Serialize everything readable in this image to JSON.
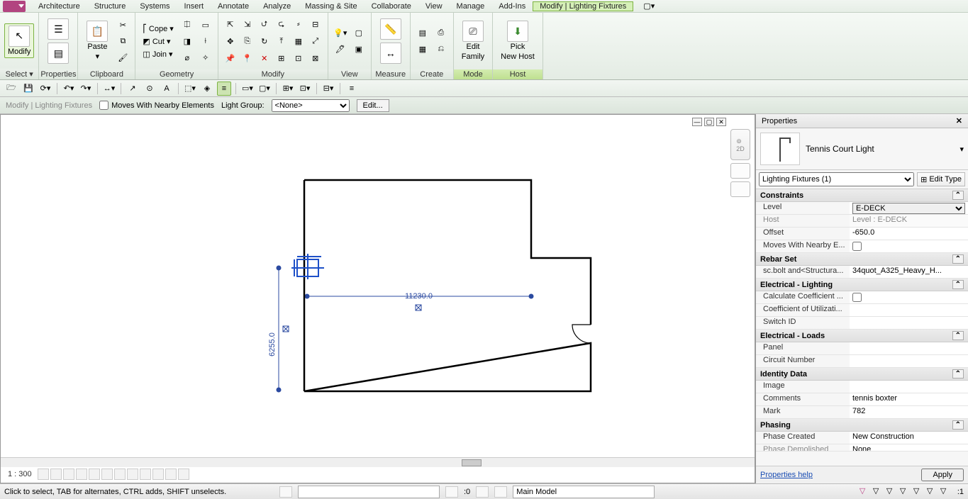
{
  "menu": {
    "items": [
      "Architecture",
      "Structure",
      "Systems",
      "Insert",
      "Annotate",
      "Analyze",
      "Massing & Site",
      "Collaborate",
      "View",
      "Manage",
      "Add-Ins"
    ],
    "contextual": "Modify | Lighting Fixtures"
  },
  "ribbon": {
    "select": {
      "modify": "Modify",
      "label": "Select ▾"
    },
    "properties": {
      "btn": "Properties",
      "label": "Properties"
    },
    "clipboard": {
      "paste": "Paste",
      "label": "Clipboard"
    },
    "geometry": {
      "cope": "Cope  ▾",
      "cut": "Cut  ▾",
      "join": "Join  ▾",
      "label": "Geometry"
    },
    "modify": {
      "label": "Modify"
    },
    "view": {
      "label": "View"
    },
    "measure": {
      "label": "Measure"
    },
    "create": {
      "label": "Create"
    },
    "mode": {
      "btn1": "Edit",
      "btn1b": "Family",
      "label": "Mode"
    },
    "host": {
      "btn1": "Pick",
      "btn1b": "New Host",
      "label": "Host"
    }
  },
  "options": {
    "context": "Modify | Lighting Fixtures",
    "moves_label": "Moves With Nearby Elements",
    "light_group_label": "Light Group:",
    "light_group_value": "<None>",
    "edit": "Edit..."
  },
  "canvas": {
    "dim_h": "11230.0",
    "dim_v": "6255.0"
  },
  "viewbar": {
    "scale": "1 : 300"
  },
  "properties": {
    "title": "Properties",
    "type_name": "Tennis Court Light",
    "filter": "Lighting Fixtures (1)",
    "edit_type": "Edit Type",
    "groups": [
      {
        "name": "Constraints",
        "rows": [
          {
            "k": "Level",
            "v": "E-DECK",
            "editable": "select"
          },
          {
            "k": "Host",
            "v": "Level : E-DECK",
            "ro": true
          },
          {
            "k": "Offset",
            "v": "-650.0"
          },
          {
            "k": "Moves With Nearby E...",
            "v": "",
            "check": false
          }
        ]
      },
      {
        "name": "Rebar Set",
        "rows": [
          {
            "k": "sc.bolt and<Structura...",
            "v": "34quot_A325_Heavy_H..."
          }
        ]
      },
      {
        "name": "Electrical - Lighting",
        "rows": [
          {
            "k": "Calculate Coefficient ...",
            "v": "",
            "check": false
          },
          {
            "k": "Coefficient of Utilizati...",
            "v": ""
          },
          {
            "k": "Switch ID",
            "v": ""
          }
        ]
      },
      {
        "name": "Electrical - Loads",
        "rows": [
          {
            "k": "Panel",
            "v": ""
          },
          {
            "k": "Circuit Number",
            "v": ""
          }
        ]
      },
      {
        "name": "Identity Data",
        "rows": [
          {
            "k": "Image",
            "v": ""
          },
          {
            "k": "Comments",
            "v": "tennis boxter"
          },
          {
            "k": "Mark",
            "v": "782"
          }
        ]
      },
      {
        "name": "Phasing",
        "rows": [
          {
            "k": "Phase Created",
            "v": "New Construction"
          },
          {
            "k": "Phase Demolished",
            "v": "None",
            "cut": true
          }
        ]
      }
    ],
    "help": "Properties help",
    "apply": "Apply"
  },
  "status": {
    "msg": "Click to select, TAB for alternates, CTRL adds, SHIFT unselects.",
    "sel": ":0",
    "workset": "Main Model",
    "filter": ":1"
  }
}
